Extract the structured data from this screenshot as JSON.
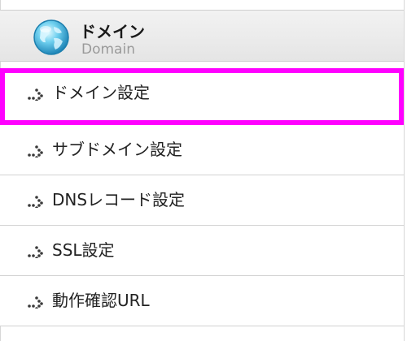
{
  "header": {
    "title": "ドメイン",
    "subtitle": "Domain",
    "icon": "globe-icon"
  },
  "menu": {
    "items": [
      {
        "label": "ドメイン設定",
        "highlighted": true
      },
      {
        "label": "サブドメイン設定",
        "highlighted": false
      },
      {
        "label": "DNSレコード設定",
        "highlighted": false
      },
      {
        "label": "SSL設定",
        "highlighted": false
      },
      {
        "label": "動作確認URL",
        "highlighted": false
      }
    ],
    "bullet_icon": "dotted-arrow-icon"
  },
  "colors": {
    "highlight": "#ff00ff",
    "header_bg": "#ebebeb",
    "text": "#222222",
    "subtitle": "#9a9a9a",
    "bullet": "#3a3a3a"
  }
}
